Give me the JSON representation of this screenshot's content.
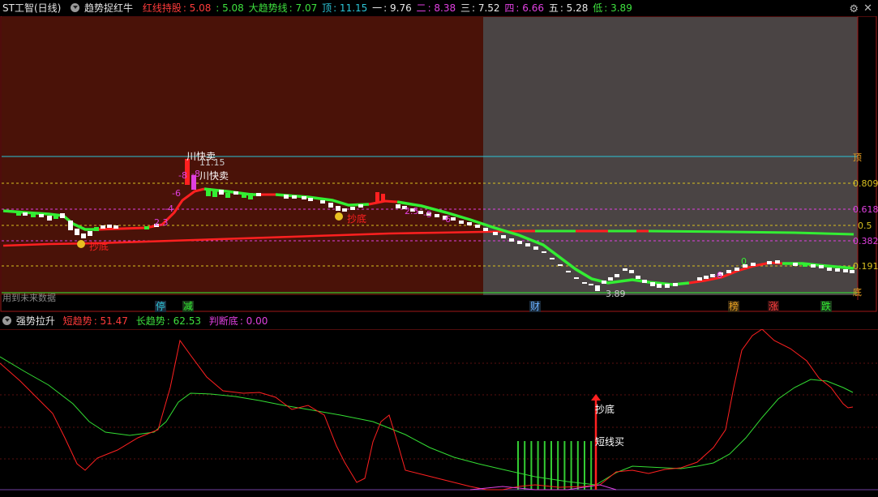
{
  "header": {
    "stock": "ST工智(日线)",
    "indicator": "趋势捉红牛",
    "red_hold_label": "红线持股",
    "red_hold_value": ": 5.08",
    "red_hold_value2": ": 5.08",
    "big_trend_label": "大趋势线",
    "big_trend_value": ": 7.07",
    "top_label": "顶",
    "top_value": ": 11.15",
    "one_label": "一",
    "one_value": ": 9.76",
    "two_label": "二",
    "two_value": ": 8.38",
    "three_label": "三",
    "three_value": ": 7.52",
    "four_label": "四",
    "four_value": ": 6.66",
    "five_label": "五",
    "five_value": ": 5.28",
    "low_label": "低",
    "low_value": ": 3.89",
    "settings_icon": "gear-icon",
    "close_icon": "close-icon"
  },
  "main_chart": {
    "right_labels": {
      "top": "顶",
      "l809": "0.809",
      "l618": "0.618",
      "l5": "0.5",
      "l382": "0.382",
      "l191": "0.191",
      "bottom": "底"
    },
    "annotations": {
      "sell1": "川快卖",
      "sell2": "川快卖",
      "peak": "11.15",
      "low": "3.89",
      "buy1": "抄底",
      "buy2": "抄底",
      "n23": "2.3",
      "n4": "-4",
      "n6": "-6",
      "n8a": "-8",
      "n8b": "-8",
      "n25": "2.5",
      "n5": "-5",
      "n6b": "-6",
      "neg6": "-6",
      "n0": "0",
      "note": "用到未来数据"
    },
    "event_labels": [
      "停",
      "减",
      "财",
      "榜",
      "涨",
      "跌"
    ],
    "colors": {
      "bull": "#ff2020",
      "bear": "#33ee33",
      "bg_left": "#4a1208",
      "bg_right": "#4a4444",
      "top_line": "#2cc4d6"
    }
  },
  "sub_chart": {
    "name": "强势拉升",
    "short_label": "短趋势",
    "short_value": ": 51.47",
    "long_label": "长趋势",
    "long_value": ": 62.53",
    "judge_label": "判断底",
    "judge_value": ": 0.00",
    "annot_buy": "抄底",
    "annot_short": "短线买"
  }
}
